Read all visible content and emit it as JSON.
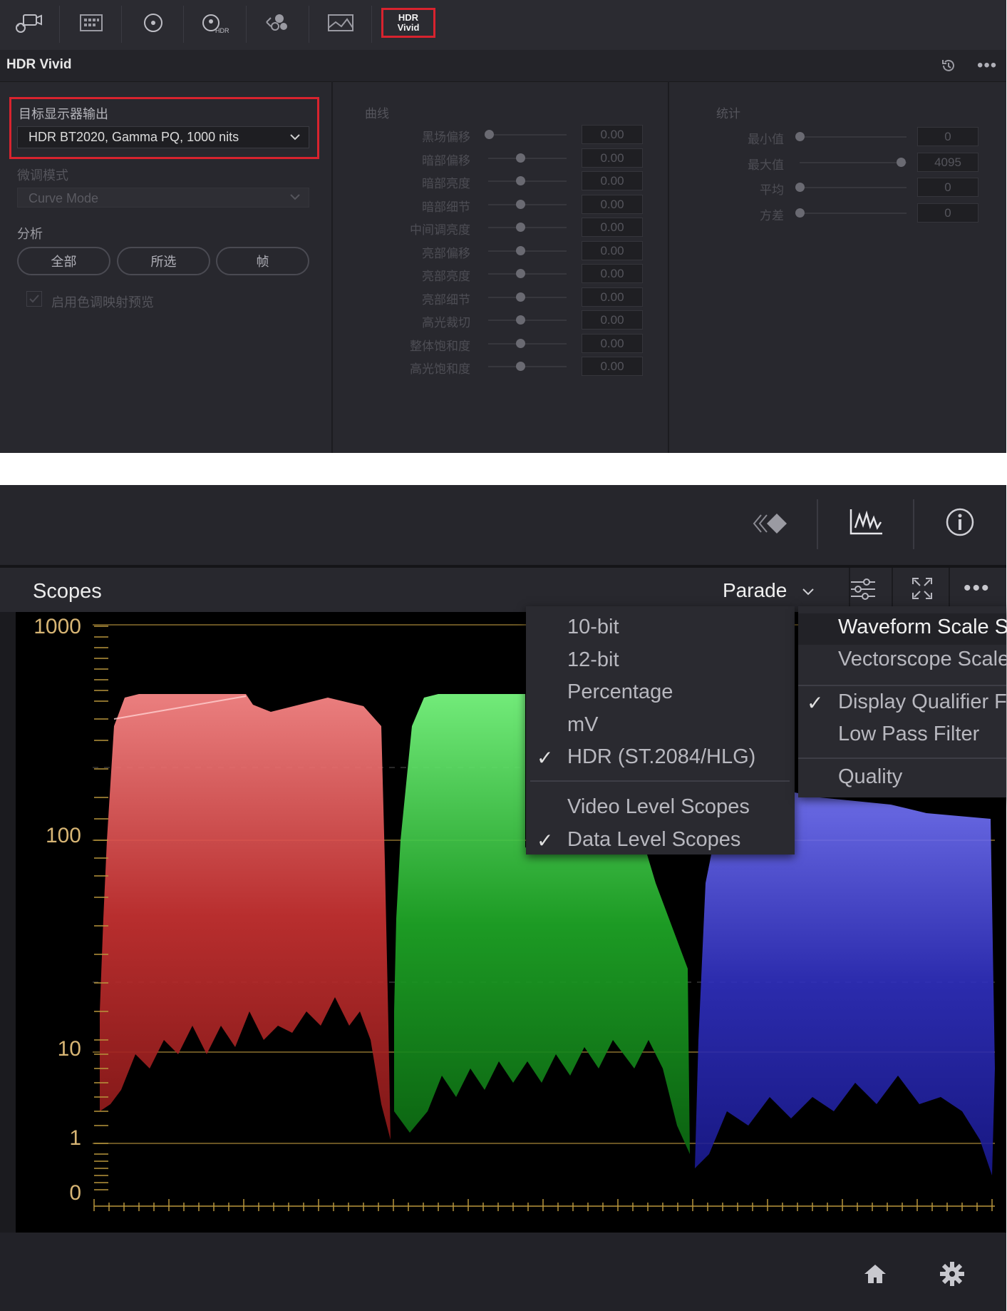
{
  "hdr_panel": {
    "badge_line1": "HDR",
    "badge_line2": "Vivid",
    "title": "HDR Vivid",
    "target_label": "目标显示器输出",
    "target_value": "HDR BT2020, Gamma PQ, 1000 nits",
    "mode_label": "微调模式",
    "mode_value": "Curve Mode",
    "analysis_label": "分析",
    "analysis_buttons": [
      "全部",
      "所选",
      "帧"
    ],
    "preview_checkbox": "启用色调映射预览",
    "preview_checked": true,
    "curve_label": "曲线",
    "curve_params": [
      {
        "label": "黑场偏移",
        "value": "0.00"
      },
      {
        "label": "暗部偏移",
        "value": "0.00"
      },
      {
        "label": "暗部亮度",
        "value": "0.00"
      },
      {
        "label": "暗部细节",
        "value": "0.00"
      },
      {
        "label": "中间调亮度",
        "value": "0.00"
      },
      {
        "label": "亮部偏移",
        "value": "0.00"
      },
      {
        "label": "亮部亮度",
        "value": "0.00"
      },
      {
        "label": "亮部细节",
        "value": "0.00"
      },
      {
        "label": "高光裁切",
        "value": "0.00"
      },
      {
        "label": "整体饱和度",
        "value": "0.00"
      },
      {
        "label": "高光饱和度",
        "value": "0.00"
      }
    ],
    "stats_label": "统计",
    "stats": [
      {
        "label": "最小值",
        "value": "0"
      },
      {
        "label": "最大值",
        "value": "4095"
      },
      {
        "label": "平均",
        "value": "0"
      },
      {
        "label": "方差",
        "value": "0"
      }
    ]
  },
  "scopes": {
    "title": "Scopes",
    "mode": "Parade",
    "axis_labels": [
      "1000",
      "100",
      "10",
      "1",
      "0"
    ],
    "scale_menu": [
      {
        "label": "10-bit",
        "checked": false
      },
      {
        "label": "12-bit",
        "checked": false
      },
      {
        "label": "Percentage",
        "checked": false
      },
      {
        "label": "mV",
        "checked": false
      },
      {
        "label": "HDR (ST.2084/HLG)",
        "checked": true
      }
    ],
    "level_menu": [
      {
        "label": "Video Level Scopes",
        "checked": false
      },
      {
        "label": "Data Level Scopes",
        "checked": true
      }
    ],
    "options_menu": [
      {
        "label": "Waveform Scale S",
        "checked": false
      },
      {
        "label": "Vectorscope Scale",
        "checked": false
      },
      {
        "label": "Display Qualifier F",
        "checked": true
      },
      {
        "label": "Low Pass Filter",
        "checked": false
      },
      {
        "label": "Quality",
        "checked": false
      }
    ]
  },
  "colors": {
    "red_channel": "#e04848",
    "green_channel": "#2fd43a",
    "blue_channel": "#4848e8",
    "graticule": "#b8963c",
    "highlight_border": "#d8232e"
  }
}
